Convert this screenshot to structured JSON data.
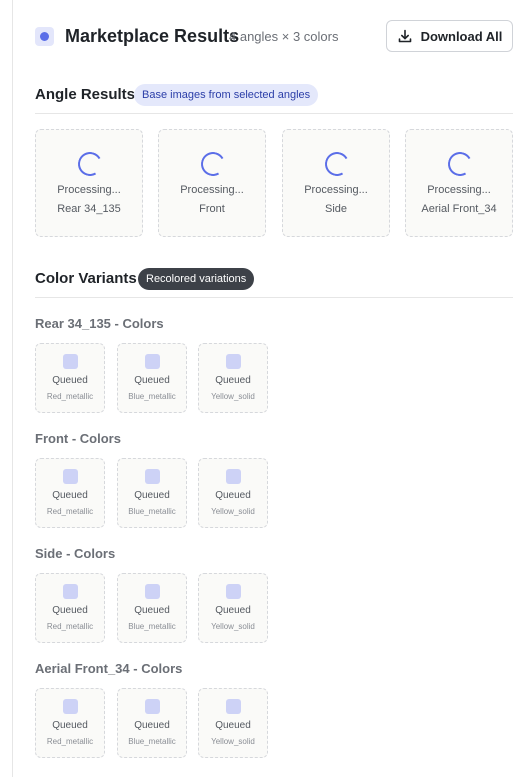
{
  "header": {
    "title": "Marketplace Results",
    "subtitle": "4 angles × 3 colors",
    "download_label": "Download All"
  },
  "angle_section": {
    "title": "Angle Results",
    "badge": "Base images from selected angles",
    "cards": [
      {
        "status": "Processing...",
        "name": "Rear 34_135"
      },
      {
        "status": "Processing...",
        "name": "Front"
      },
      {
        "status": "Processing...",
        "name": "Side"
      },
      {
        "status": "Processing...",
        "name": "Aerial Front_34"
      }
    ]
  },
  "color_section": {
    "title": "Color Variants",
    "badge": "Recolored variations",
    "groups": [
      {
        "title": "Rear 34_135 - Colors",
        "items": [
          {
            "status": "Queued",
            "name": "Red_metallic"
          },
          {
            "status": "Queued",
            "name": "Blue_metallic"
          },
          {
            "status": "Queued",
            "name": "Yellow_solid"
          }
        ]
      },
      {
        "title": "Front - Colors",
        "items": [
          {
            "status": "Queued",
            "name": "Red_metallic"
          },
          {
            "status": "Queued",
            "name": "Blue_metallic"
          },
          {
            "status": "Queued",
            "name": "Yellow_solid"
          }
        ]
      },
      {
        "title": "Side - Colors",
        "items": [
          {
            "status": "Queued",
            "name": "Red_metallic"
          },
          {
            "status": "Queued",
            "name": "Blue_metallic"
          },
          {
            "status": "Queued",
            "name": "Yellow_solid"
          }
        ]
      },
      {
        "title": "Aerial Front_34 - Colors",
        "items": [
          {
            "status": "Queued",
            "name": "Red_metallic"
          },
          {
            "status": "Queued",
            "name": "Blue_metallic"
          },
          {
            "status": "Queued",
            "name": "Yellow_solid"
          }
        ]
      }
    ]
  },
  "colors": {
    "accent": "#5b6ee8",
    "badge_light_bg": "#e4e8fb",
    "badge_dark_bg": "#3d4148"
  }
}
